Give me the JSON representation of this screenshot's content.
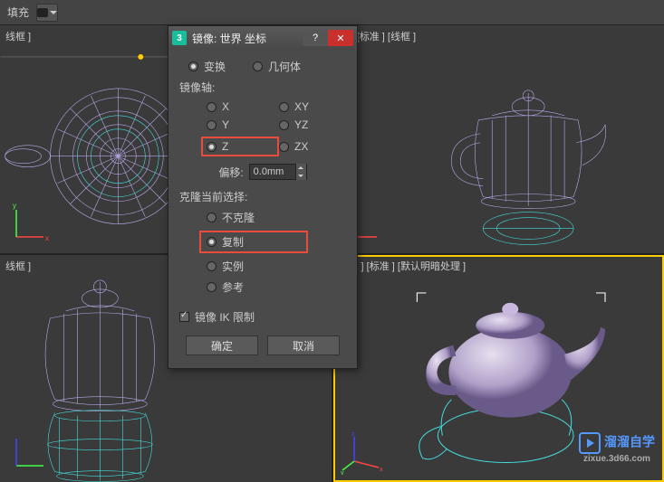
{
  "toolbar": {
    "fill_label": "填充"
  },
  "viewports": {
    "tl_label": "线框 ]",
    "tr_label": "前 ] [标准 ] [线框 ]",
    "bl_label": "线框 ]",
    "br_label": "透视 ] [标准 ] [默认明暗处理 ]"
  },
  "watermark": {
    "brand": "溜溜自学",
    "url": "zixue.3d66.com"
  },
  "dialog": {
    "title": "镜像: 世界 坐标",
    "icon_text": "3",
    "mode": {
      "transform": "变换",
      "geometry": "几何体"
    },
    "axis_label": "镜像轴:",
    "axes": {
      "x": "X",
      "y": "Y",
      "z": "Z",
      "xy": "XY",
      "yz": "YZ",
      "zx": "ZX"
    },
    "offset_label": "偏移:",
    "offset_value": "0.0mm",
    "clone_label": "克隆当前选择:",
    "clone": {
      "none": "不克隆",
      "copy": "复制",
      "instance": "实例",
      "reference": "参考"
    },
    "ik_label": "镜像 IK 限制",
    "ok": "确定",
    "cancel": "取消"
  }
}
